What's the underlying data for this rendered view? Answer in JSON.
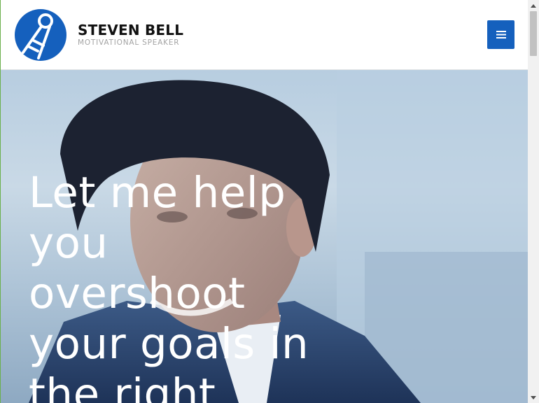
{
  "header": {
    "brand_name": "STEVEN BELL",
    "tagline": "MOTIVATIONAL SPEAKER",
    "logo_icon": "key-in-circle-logo",
    "menu_icon": "hamburger-icon"
  },
  "hero": {
    "heading": "Let me help you overshoot your goals in the right",
    "photo": "smiling-man-portrait"
  },
  "colors": {
    "brand_blue": "#1560bd",
    "heading_text": "#ffffff",
    "brand_text": "#111111",
    "tagline_text": "#a3a3a3"
  }
}
